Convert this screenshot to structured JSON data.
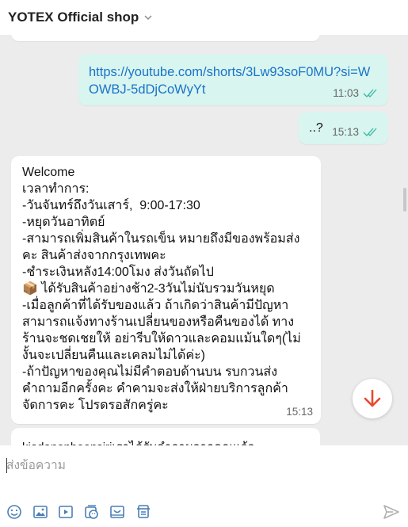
{
  "header": {
    "shop_name": "YOTEX Official shop"
  },
  "messages": [
    {
      "direction": "out",
      "text": "https://youtube.com/shorts/3Lw93soF0MU?si=WOWBJ-5dDjCoWyYt",
      "time": "11:03",
      "status": "read"
    },
    {
      "direction": "out",
      "text": "..?",
      "time": "15:13",
      "status": "read"
    },
    {
      "direction": "in",
      "text": "Welcome\nเวลาทำการ:\n-วันจันทร์ถึงวันเสาร์,  9:00-17:30\n-หยุดวันอาทิตย์\n-สามารถเพิ่มสินค้าในรถเข็น หมายถึงมีของพร้อมส่ง\nคะ สินค้าส่งจากกรุงเทพคะ\n-ชำระเงินหลัง14:00โมง ส่งวันถัดไป\n📦 ได้รับสินค้าอย่างช้า2-3วันไม่นับรวมวันหยุด\n-เมื่อลูกค้าที่ได้รับของแล้ว ถ้าเกิดว่าสินค้ามีปัญหา\nสามารถแจ้งทางร้านเปลี่ยนของหรือคืนของได้ ทาง\nร้านจะชดเชยให้ อย่ารีบให้ดาวและคอมแม้นใดๆ(ไม่\nงั้นจะเปลี่ยนคืนและเคลมไม่ได้ค่ะ)\n-ถ้าปัญหาของคุณไม่มีคำตอบด้านบน รบกวนส่ง\nคำถามอีกครั้งคะ คำคามจะส่งให้ฝ่ายบริการลูกค้า\nจัดการคะ โปรดรอสักครู่คะ",
      "time": "15:13"
    },
    {
      "direction": "in",
      "text": "kiadanonboonsiriเราได้รับคำถามจากคุณแล้ว"
    }
  ],
  "composer": {
    "placeholder": "ส่งข้อความ"
  },
  "toolbar": {
    "icons": [
      "emoji-icon",
      "image-icon",
      "video-icon",
      "sticker-icon",
      "product-icon",
      "order-icon"
    ]
  },
  "colors": {
    "outgoing_bubble": "#d8f5ef",
    "link": "#1a73c9",
    "fab_arrow": "#e8492f",
    "read_ticks": "#3bb8a3"
  }
}
